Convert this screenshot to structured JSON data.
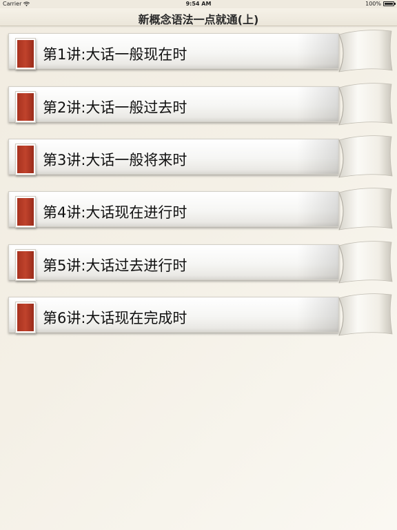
{
  "status_bar": {
    "carrier": "Carrier",
    "time": "9:54 AM",
    "battery": "100%"
  },
  "nav": {
    "title": "新概念语法一点就通(上)"
  },
  "lessons": [
    {
      "label": "第1讲:大话一般现在时"
    },
    {
      "label": "第2讲:大话一般过去时"
    },
    {
      "label": "第3讲:大话一般将来时"
    },
    {
      "label": "第4讲:大话现在进行时"
    },
    {
      "label": "第5讲:大话过去进行时"
    },
    {
      "label": "第6讲:大话现在完成时"
    }
  ],
  "colors": {
    "marker_red": "#b53a25",
    "background": "#f3efe5"
  },
  "icons": {
    "wifi": "wifi-icon",
    "battery": "battery-icon",
    "bookmark": "red-bookmark-icon",
    "curl": "page-curl-icon"
  }
}
